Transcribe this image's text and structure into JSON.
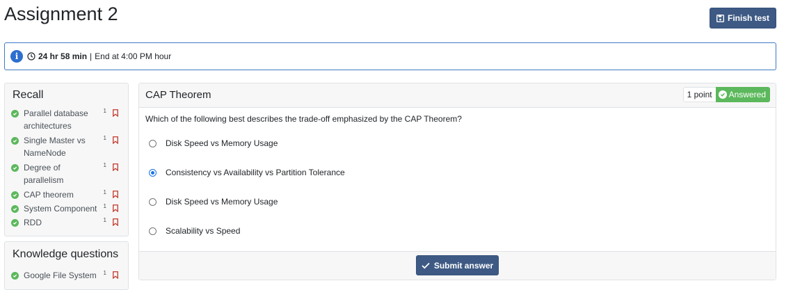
{
  "page": {
    "title": "Assignment 2",
    "finish_label": "Finish test"
  },
  "timer": {
    "remaining": "24 hr 58 min",
    "separator": "|",
    "end_text": "End at 4:00 PM hour"
  },
  "sidebar": {
    "recall": {
      "heading": "Recall",
      "items": [
        {
          "label": "Parallel database architectures",
          "points": "1"
        },
        {
          "label": "Single Master vs NameNode",
          "points": "1"
        },
        {
          "label": "Degree of parallelism",
          "points": "1"
        },
        {
          "label": "CAP theorem",
          "points": "1"
        },
        {
          "label": "System Component",
          "points": "1"
        },
        {
          "label": "RDD",
          "points": "1"
        }
      ]
    },
    "knowledge": {
      "heading": "Knowledge questions",
      "items": [
        {
          "label": "Google File System",
          "points": "1"
        }
      ]
    }
  },
  "question": {
    "title": "CAP Theorem",
    "points": "1 point",
    "status": "Answered",
    "text": "Which of the following best describes the trade-off emphasized by the CAP Theorem?",
    "options": [
      {
        "label": "Disk Speed vs Memory Usage",
        "selected": false
      },
      {
        "label": "Consistency vs Availability vs Partition Tolerance",
        "selected": true
      },
      {
        "label": "Disk Speed vs Memory Usage",
        "selected": false
      },
      {
        "label": "Scalability vs Speed",
        "selected": false
      }
    ],
    "submit_label": "Submit answer"
  },
  "colors": {
    "primary": "#3e5a84",
    "success": "#5cb85c",
    "info": "#2d6fcf",
    "bookmark": "#c0392b"
  }
}
